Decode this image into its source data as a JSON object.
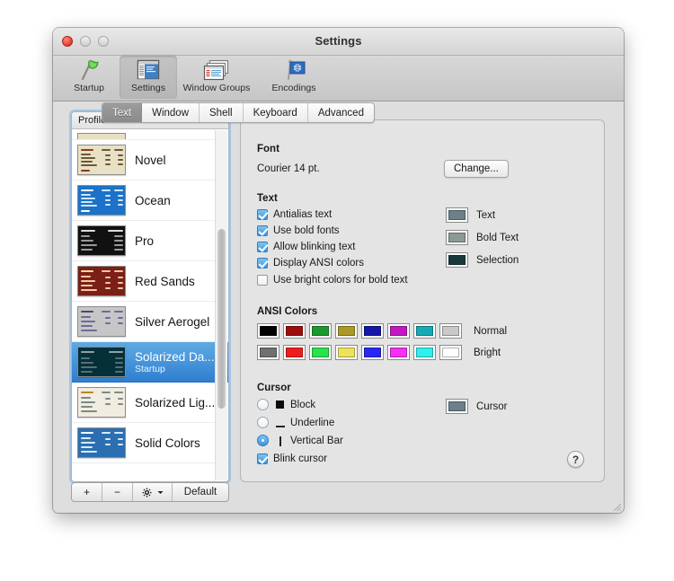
{
  "window": {
    "title": "Settings",
    "traffic_lights": [
      "close-button",
      "minimize-button",
      "zoom-button"
    ]
  },
  "toolbar": {
    "items": [
      {
        "label": "Startup",
        "icon": "flag-icon",
        "selected": false
      },
      {
        "label": "Settings",
        "icon": "settings-window-icon",
        "selected": true
      },
      {
        "label": "Window Groups",
        "icon": "window-groups-icon",
        "selected": false
      },
      {
        "label": "Encodings",
        "icon": "encodings-globe-icon",
        "selected": false
      }
    ]
  },
  "profiles": {
    "header": "Profiles",
    "items": [
      {
        "name": "Novel",
        "subtitle": "",
        "bg": "#e9e1c6",
        "fg": "#6a5a3a",
        "accent": "#8a3a22"
      },
      {
        "name": "Ocean",
        "subtitle": "",
        "bg": "#1b72c8",
        "fg": "#cfe6fb",
        "accent": "#ffffff"
      },
      {
        "name": "Pro",
        "subtitle": "",
        "bg": "#111111",
        "fg": "#cfcfcf",
        "accent": "#8f8f8f"
      },
      {
        "name": "Red Sands",
        "subtitle": "",
        "bg": "#7b1f18",
        "fg": "#f0c9a0",
        "accent": "#ffd8a8"
      },
      {
        "name": "Silver Aerogel",
        "subtitle": "",
        "bg": "#c6c6c6",
        "fg": "#4b4b66",
        "accent": "#6b6b9a"
      },
      {
        "name": "Solarized Da...",
        "subtitle": "Startup",
        "bg": "#04303a",
        "fg": "#93a1a1",
        "accent": "#268bd2",
        "selected": true
      },
      {
        "name": "Solarized Lig...",
        "subtitle": "",
        "bg": "#f1ece0",
        "fg": "#7b8a8a",
        "accent": "#b58900"
      },
      {
        "name": "Solid Colors",
        "subtitle": "",
        "bg": "#2b6fb0",
        "fg": "#d7e9f8",
        "accent": "#ffffff"
      }
    ],
    "buttons": {
      "add": "+",
      "remove": "−",
      "gear": "gear-icon",
      "gear_chevron": "chevron-down-icon",
      "default": "Default"
    }
  },
  "tabs": [
    {
      "label": "Text",
      "active": true
    },
    {
      "label": "Window",
      "active": false
    },
    {
      "label": "Shell",
      "active": false
    },
    {
      "label": "Keyboard",
      "active": false
    },
    {
      "label": "Advanced",
      "active": false
    }
  ],
  "font_section": {
    "title": "Font",
    "value": "Courier 14 pt.",
    "change_button": "Change..."
  },
  "text_section": {
    "title": "Text",
    "checkboxes": [
      {
        "label": "Antialias text",
        "checked": true
      },
      {
        "label": "Use bold fonts",
        "checked": true
      },
      {
        "label": "Allow blinking text",
        "checked": true
      },
      {
        "label": "Display ANSI colors",
        "checked": true
      },
      {
        "label": "Use bright colors for bold text",
        "checked": false
      }
    ],
    "color_wells": [
      {
        "label": "Text",
        "color": "#6b8088"
      },
      {
        "label": "Bold Text",
        "color": "#8a9a96"
      },
      {
        "label": "Selection",
        "color": "#17383d"
      }
    ]
  },
  "ansi_section": {
    "title": "ANSI Colors",
    "rows": [
      {
        "label": "Normal",
        "colors": [
          "#000000",
          "#9d0d0d",
          "#1a9a2e",
          "#a99a28",
          "#1616a8",
          "#c317c3",
          "#15aab5",
          "#c9c9c9"
        ]
      },
      {
        "label": "Bright",
        "colors": [
          "#707070",
          "#f01c1c",
          "#29e24c",
          "#ece35c",
          "#2828f5",
          "#f62ef6",
          "#2ef0f0",
          "#ffffff"
        ]
      }
    ]
  },
  "cursor_section": {
    "title": "Cursor",
    "options": [
      {
        "label": "Block",
        "glyph": "block-glyph",
        "selected": false
      },
      {
        "label": "Underline",
        "glyph": "underline-glyph",
        "selected": false
      },
      {
        "label": "Vertical Bar",
        "glyph": "vertical-bar-glyph",
        "selected": true
      }
    ],
    "blink": {
      "label": "Blink cursor",
      "checked": true
    },
    "color_well": {
      "label": "Cursor",
      "color": "#6b8088"
    }
  },
  "help_button": {
    "label": "?"
  }
}
